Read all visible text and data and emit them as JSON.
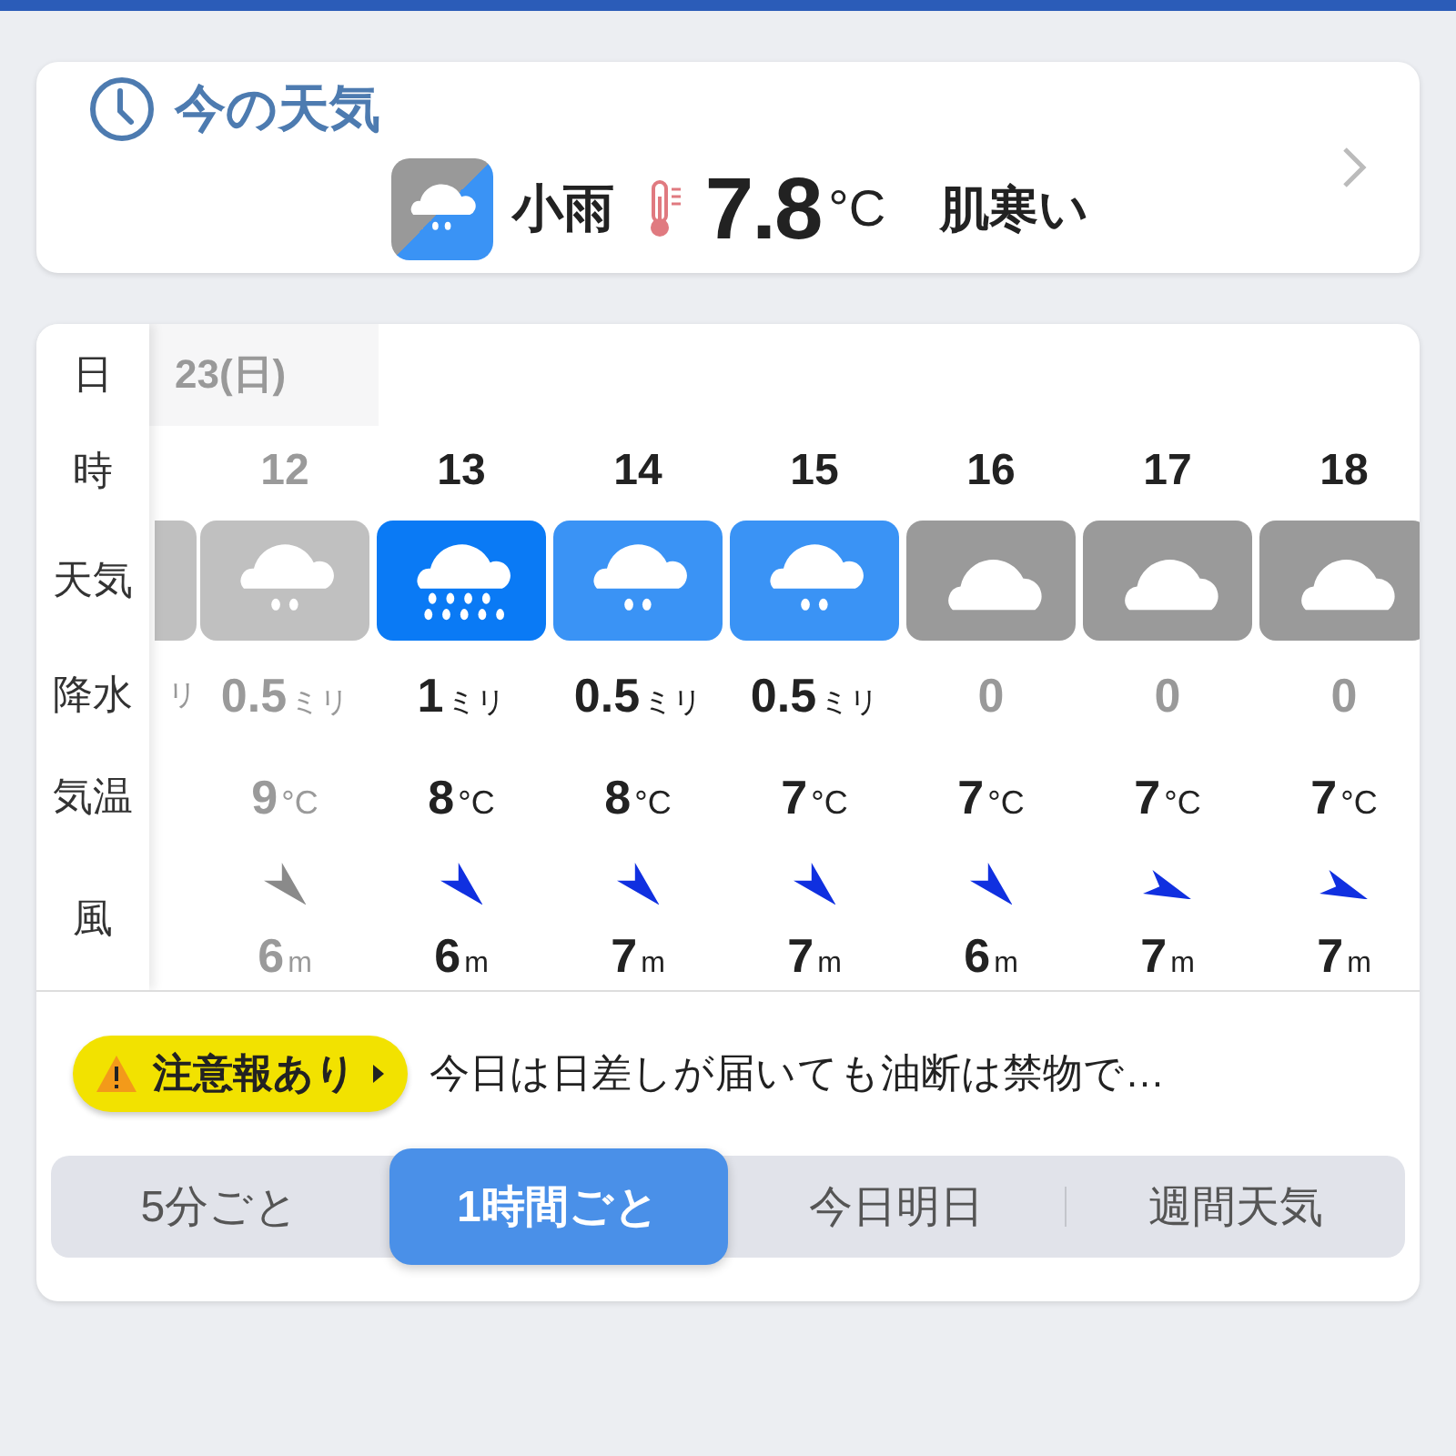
{
  "current": {
    "title": "今の天気",
    "kind": "rain",
    "condition": "小雨",
    "temperature": "7.8",
    "unit": "°C",
    "feel": "肌寒い"
  },
  "forecast": {
    "row_labels": [
      "日",
      "時",
      "天気",
      "降水",
      "気温",
      "風"
    ],
    "date": "23(日)",
    "partial": {
      "kind": "rain",
      "past": true,
      "precip": "リ"
    },
    "hours": [
      {
        "hour": "12",
        "kind": "rain",
        "past": true,
        "precip": "0.5",
        "precip_unit": "ミリ",
        "temp": "9",
        "temp_unit": "°C",
        "wind": {
          "kind": "nw",
          "speed": "6",
          "unit": "m"
        }
      },
      {
        "hour": "13",
        "kind": "heavy_rain",
        "past": false,
        "precip": "1",
        "precip_unit": "ミリ",
        "temp": "8",
        "temp_unit": "°C",
        "wind": {
          "kind": "nw",
          "speed": "6",
          "unit": "m"
        }
      },
      {
        "hour": "14",
        "kind": "rain",
        "past": false,
        "precip": "0.5",
        "precip_unit": "ミリ",
        "temp": "8",
        "temp_unit": "°C",
        "wind": {
          "kind": "nw",
          "speed": "7",
          "unit": "m"
        }
      },
      {
        "hour": "15",
        "kind": "rain",
        "past": false,
        "precip": "0.5",
        "precip_unit": "ミリ",
        "temp": "7",
        "temp_unit": "°C",
        "wind": {
          "kind": "nw",
          "speed": "7",
          "unit": "m"
        }
      },
      {
        "hour": "16",
        "kind": "cloudy",
        "past": false,
        "precip": "0",
        "temp": "7",
        "temp_unit": "°C",
        "wind": {
          "kind": "nw",
          "speed": "6",
          "unit": "m"
        }
      },
      {
        "hour": "17",
        "kind": "cloudy",
        "past": false,
        "precip": "0",
        "temp": "7",
        "temp_unit": "°C",
        "wind": {
          "kind": "wnw",
          "speed": "7",
          "unit": "m"
        }
      },
      {
        "hour": "18",
        "kind": "cloudy",
        "past": false,
        "precip": "0",
        "temp": "7",
        "temp_unit": "°C",
        "wind": {
          "kind": "wnw",
          "speed": "7",
          "unit": "m"
        }
      }
    ]
  },
  "alert": {
    "label": "注意報あり",
    "text": "今日は日差しが届いても油断は禁物で…"
  },
  "tabs": [
    {
      "label": "5分ごと",
      "selected": false
    },
    {
      "label": "1時間ごと",
      "selected": true
    },
    {
      "label": "今日明日",
      "selected": false
    },
    {
      "label": "週間天気",
      "selected": false
    }
  ]
}
